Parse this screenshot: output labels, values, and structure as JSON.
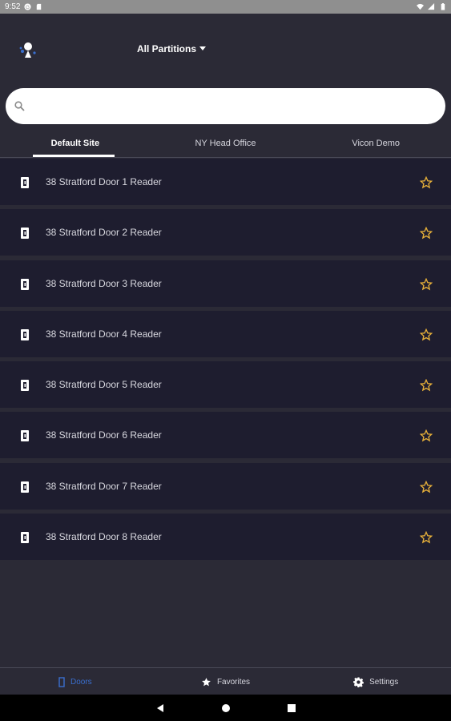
{
  "status_bar": {
    "time": "9:52"
  },
  "header": {
    "partition_label": "All Partitions",
    "search": {
      "value": "",
      "placeholder": ""
    }
  },
  "tabs": [
    {
      "label": "Default Site",
      "active": true
    },
    {
      "label": "NY Head Office",
      "active": false
    },
    {
      "label": "Vicon Demo",
      "active": false
    }
  ],
  "doors": [
    {
      "label": "38 Stratford Door 1 Reader"
    },
    {
      "label": "38 Stratford Door 2 Reader"
    },
    {
      "label": "38 Stratford Door 3 Reader"
    },
    {
      "label": "38 Stratford Door 4 Reader"
    },
    {
      "label": "38 Stratford Door 5 Reader"
    },
    {
      "label": "38 Stratford Door 6 Reader"
    },
    {
      "label": "38 Stratford Door 7 Reader"
    },
    {
      "label": "38 Stratford Door 8 Reader"
    }
  ],
  "bottom_nav": [
    {
      "label": "Doors",
      "icon": "door-icon",
      "active": true
    },
    {
      "label": "Favorites",
      "icon": "star-icon",
      "active": false
    },
    {
      "label": "Settings",
      "icon": "gear-icon",
      "active": false
    }
  ],
  "colors": {
    "background": "#2b2a36",
    "row_background": "#1e1d2f",
    "star_color": "#e8b13a",
    "active_nav": "#3a6fcf"
  }
}
